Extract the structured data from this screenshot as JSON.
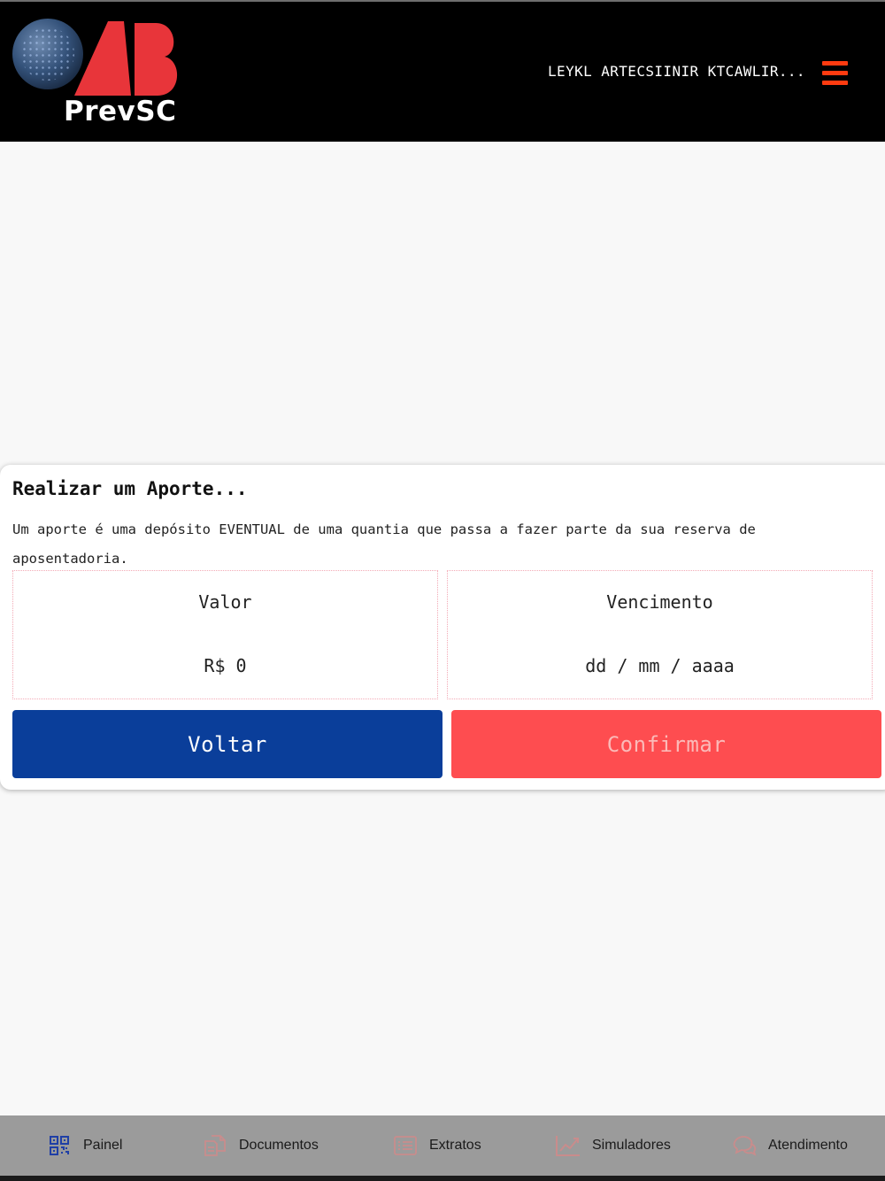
{
  "header": {
    "logo": {
      "brand_top": "OAB",
      "brand_prefix": "Prev",
      "brand_suffix": "SC"
    },
    "user_name": "LEYKL ARTECSIINIR KTCAWLIR...",
    "menu_icon": "hamburger-icon",
    "accent_color": "#ff3b10"
  },
  "aporte": {
    "title": "Realizar um Aporte...",
    "description": "Um aporte é uma depósito EVENTUAL de uma quantia que passa a fazer parte da sua reserva de aposentadoria.",
    "valor": {
      "label": "Valor",
      "value": "R$ 0"
    },
    "vencimento": {
      "label": "Vencimento",
      "placeholder": "dd / mm / aaaa"
    },
    "buttons": {
      "back": "Voltar",
      "confirm": "Confirmar"
    },
    "colors": {
      "back": "#0a3e9a",
      "confirm": "#fe4d50"
    }
  },
  "bottom_nav": {
    "items": [
      {
        "label": "Painel",
        "icon": "qr-code-icon"
      },
      {
        "label": "Documentos",
        "icon": "documents-icon"
      },
      {
        "label": "Extratos",
        "icon": "list-icon"
      },
      {
        "label": "Simuladores",
        "icon": "chart-line-icon"
      },
      {
        "label": "Atendimento",
        "icon": "chat-bubbles-icon"
      }
    ]
  }
}
